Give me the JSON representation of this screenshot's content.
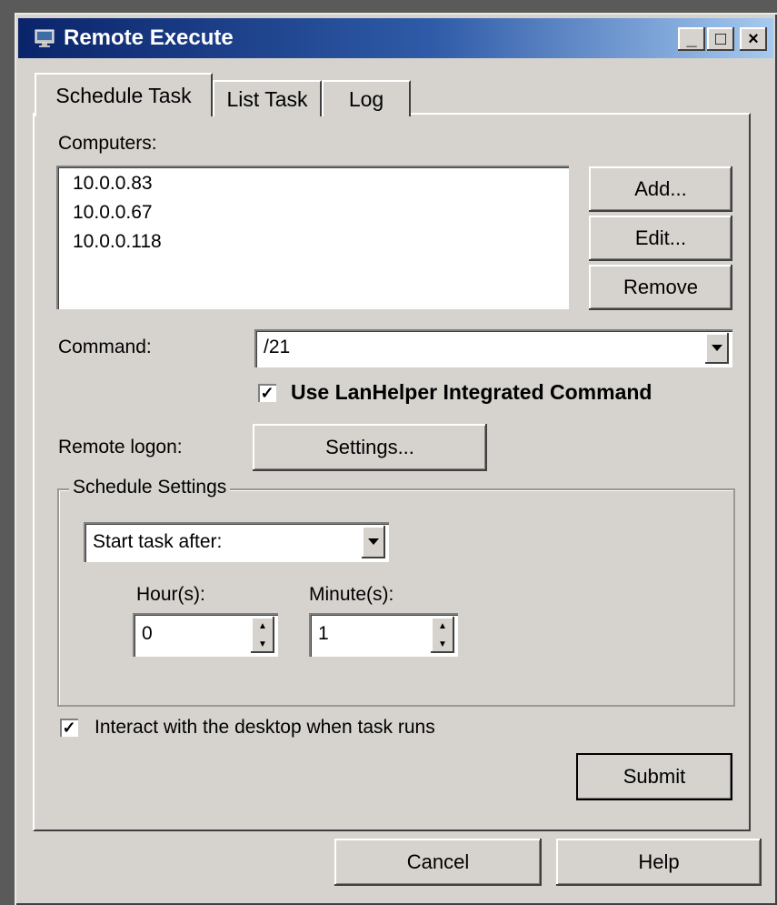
{
  "window": {
    "title": "Remote Execute"
  },
  "titlebar_buttons": {
    "minimize": "_",
    "maximize": "□",
    "close": "×"
  },
  "tabs": [
    {
      "label": "Schedule Task",
      "active": true
    },
    {
      "label": "List Task",
      "active": false
    },
    {
      "label": "Log",
      "active": false
    }
  ],
  "computers": {
    "label": "Computers:",
    "items": [
      "10.0.0.83",
      "10.0.0.67",
      "10.0.0.118"
    ],
    "add_label": "Add...",
    "edit_label": "Edit...",
    "remove_label": "Remove"
  },
  "command": {
    "label": "Command:",
    "value": "/21",
    "integrated_checkbox_label": "Use LanHelper Integrated Command",
    "integrated_checked": true
  },
  "remote_logon": {
    "label": "Remote logon:",
    "settings_label": "Settings..."
  },
  "schedule": {
    "group_title": "Schedule Settings",
    "mode_selected": "Start task after:",
    "hours_label": "Hour(s):",
    "hours_value": "0",
    "minutes_label": "Minute(s):",
    "minutes_value": "1"
  },
  "interact": {
    "label": "Interact with the desktop when task runs",
    "checked": true
  },
  "buttons": {
    "submit": "Submit",
    "cancel": "Cancel",
    "help": "Help"
  }
}
